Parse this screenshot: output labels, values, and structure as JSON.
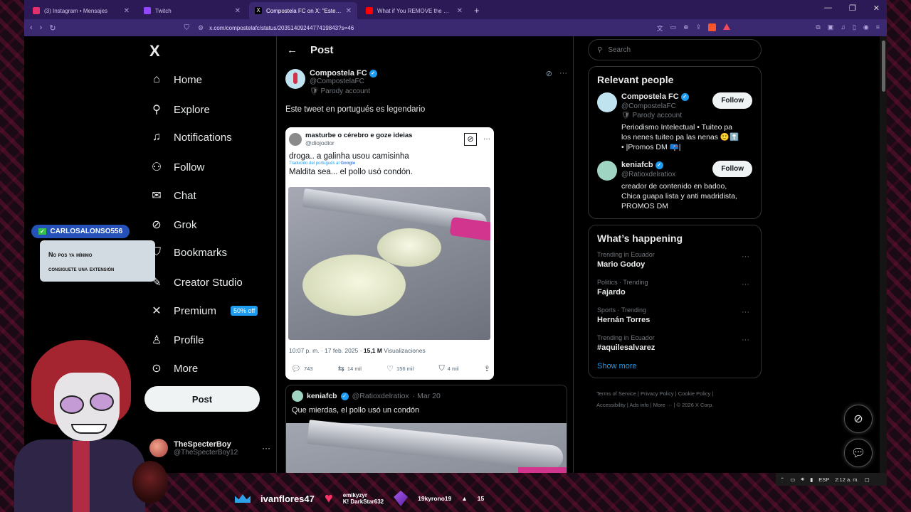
{
  "browser": {
    "tabs": [
      {
        "title": "(3) Instagram • Mensajes",
        "color": "#e1306c",
        "active": false
      },
      {
        "title": "Twitch",
        "color": "#9146ff",
        "active": false
      },
      {
        "title": "Compostela FC on X: \"Este twee",
        "color": "#ffffff",
        "active": true
      },
      {
        "title": "What if You REMOVE the Darkness in",
        "color": "#ff0000",
        "active": false
      }
    ],
    "url": "x.com/compostelafc/status/2035140924477419843?s=46"
  },
  "nav": {
    "logo": "X",
    "items": [
      {
        "label": "Home",
        "icon": "home-icon",
        "glyph": "⌂"
      },
      {
        "label": "Explore",
        "icon": "search-icon",
        "glyph": "⚲"
      },
      {
        "label": "Notifications",
        "icon": "bell-icon",
        "glyph": "🔔︎"
      },
      {
        "label": "Follow",
        "icon": "follow-icon",
        "glyph": "⚇"
      },
      {
        "label": "Chat",
        "icon": "mail-icon",
        "glyph": "✉"
      },
      {
        "label": "Grok",
        "icon": "grok-icon",
        "glyph": "⊘"
      },
      {
        "label": "Bookmarks",
        "icon": "bookmark-icon",
        "glyph": "⛉"
      },
      {
        "label": "Creator Studio",
        "icon": "creator-icon",
        "glyph": "✎"
      },
      {
        "label": "Premium",
        "icon": "x-premium-icon",
        "glyph": "𝕏"
      },
      {
        "label": "Profile",
        "icon": "profile-icon",
        "glyph": "⚲"
      },
      {
        "label": "More",
        "icon": "more-icon",
        "glyph": "⋯"
      }
    ],
    "premium_badge": "50% off",
    "post_button": "Post",
    "account": {
      "name": "TheSpecterBoy",
      "handle": "@TheSpecterBoy12"
    }
  },
  "post": {
    "header_title": "Post",
    "author_name": "Compostela FC",
    "author_handle": "@CompostelaFC",
    "parody": "Parody account",
    "text": "Este tweet en portugués es legendario",
    "embed": {
      "name": "masturbe o cérebro e goze ideias",
      "handle": "@diojodior",
      "original": "droga.. a galinha usou camisinha",
      "translated_label": "Traducido del portugués al",
      "translated_brand": "Google",
      "translated": "Maldita sea... el pollo usó condón.",
      "time": "10:07 p. m. · 17 feb. 2025 ·",
      "views": "15,1 M",
      "views_label": "Visualizaciones",
      "replies": "743",
      "retweets": "14 mil",
      "likes": "156 mil",
      "bookmarks": "4 mil"
    },
    "reply": {
      "name": "keniafcb",
      "handle": "@Ratioxdelratiox",
      "date": "· Mar 20",
      "text": "Que mierdas, el pollo usó un condón"
    }
  },
  "sidebar": {
    "search_placeholder": "Search",
    "relevant_title": "Relevant people",
    "people": [
      {
        "name": "Compostela FC",
        "handle": "@CompostelaFC",
        "parody": "Parody account",
        "bio": "Periodismo Intelectual • Tuiteo pa los nenes tuiteo pa las nenas 🙂⬆️ • |Promos DM 📪|",
        "follow": "Follow",
        "avatar_color": "#bfe3ef"
      },
      {
        "name": "keniafcb",
        "handle": "@Ratioxdelratiox",
        "parody": "",
        "bio": "creador de contenido en badoo, Chica guapa lista y anti madridista, PROMOS DM",
        "follow": "Follow",
        "avatar_color": "#9fd3c2"
      }
    ],
    "happening_title": "What’s happening",
    "trends": [
      {
        "category": "Trending in Ecuador",
        "name": "Mario Godoy"
      },
      {
        "category": "Politics · Trending",
        "name": "Fajardo"
      },
      {
        "category": "Sports · Trending",
        "name": "Hernán Torres"
      },
      {
        "category": "Trending in Ecuador",
        "name": "#aquilesalvarez"
      }
    ],
    "show_more": "Show more",
    "footer_line1": "Terms of Service  |  Privacy Policy  |  Cookie Policy  |",
    "footer_line2": "Accessibility  |  Ads info  |  More ···  |  © 2026 X Corp."
  },
  "taskbar": {
    "lang": "ESP",
    "time": "2:12 a. m."
  },
  "overlay": {
    "chat_user": "CARLOSALONSO556",
    "chat_text_1": "No pos ya mínimo",
    "chat_text_2": "consiguete una extensión",
    "alert_name": "ivanflores47",
    "alert_small_1": "emikyzyr",
    "alert_small_2": "K! DarkStar632",
    "alert_sub": "19kyrono19",
    "alert_count": "15"
  }
}
